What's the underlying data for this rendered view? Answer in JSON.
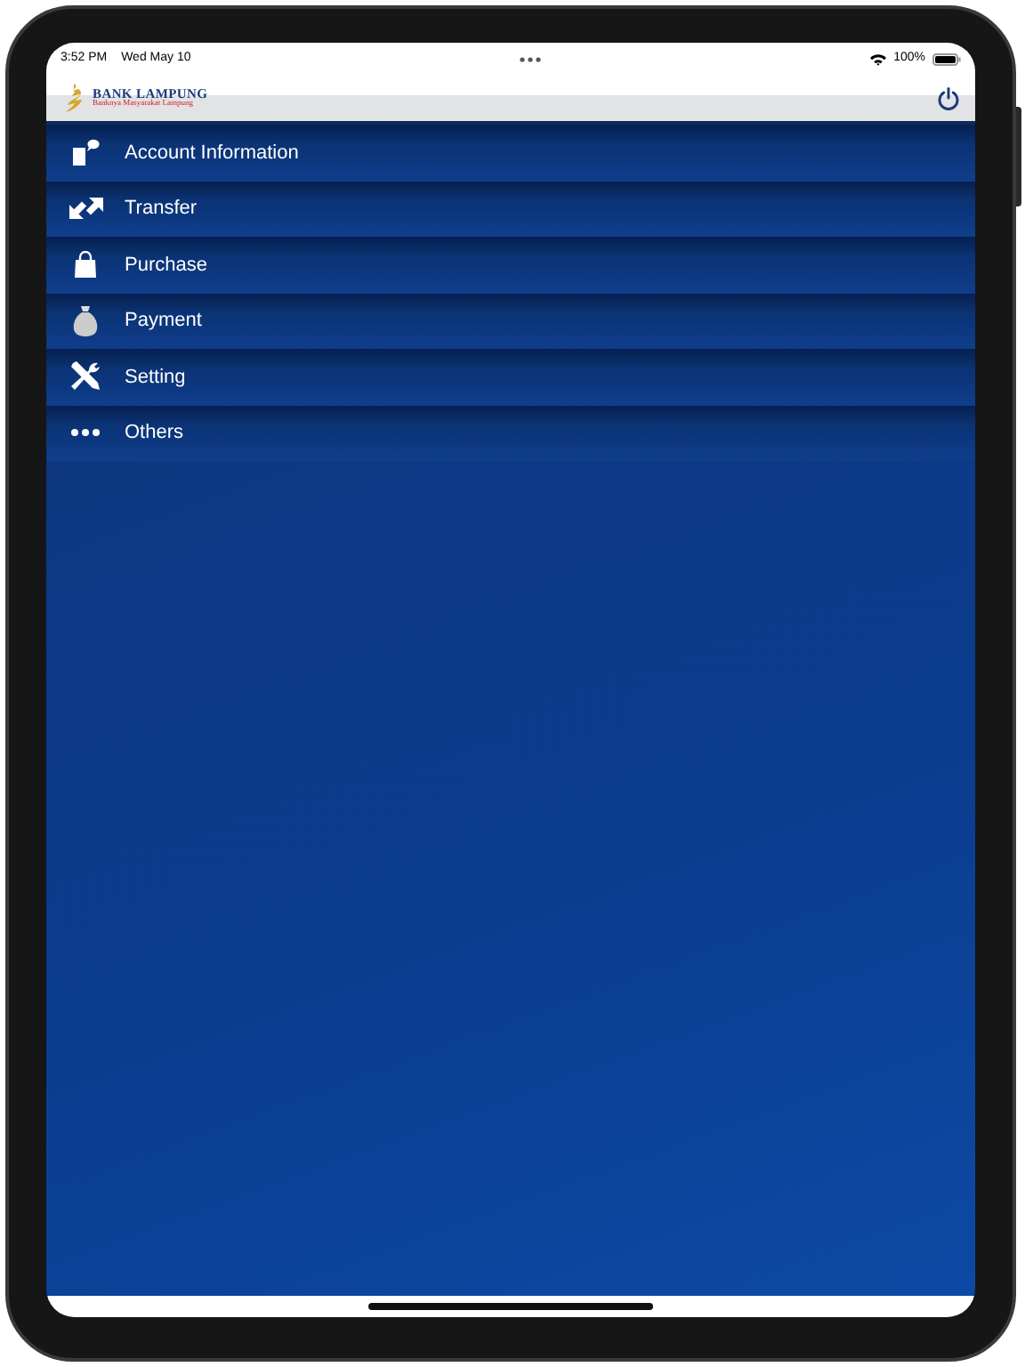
{
  "status_bar": {
    "time": "3:52 PM",
    "date": "Wed May 10",
    "battery": "100%"
  },
  "header": {
    "logo_title": "BANK LAMPUNG",
    "logo_subtitle": "Banknya Masyarakat Lampung"
  },
  "menu": [
    {
      "label": "Account Information",
      "kind": "account"
    },
    {
      "label": "Transfer",
      "kind": "transfer"
    },
    {
      "label": "Purchase",
      "kind": "purchase"
    },
    {
      "label": "Payment",
      "kind": "payment"
    },
    {
      "label": "Setting",
      "kind": "setting"
    },
    {
      "label": "Others",
      "kind": "others"
    }
  ]
}
